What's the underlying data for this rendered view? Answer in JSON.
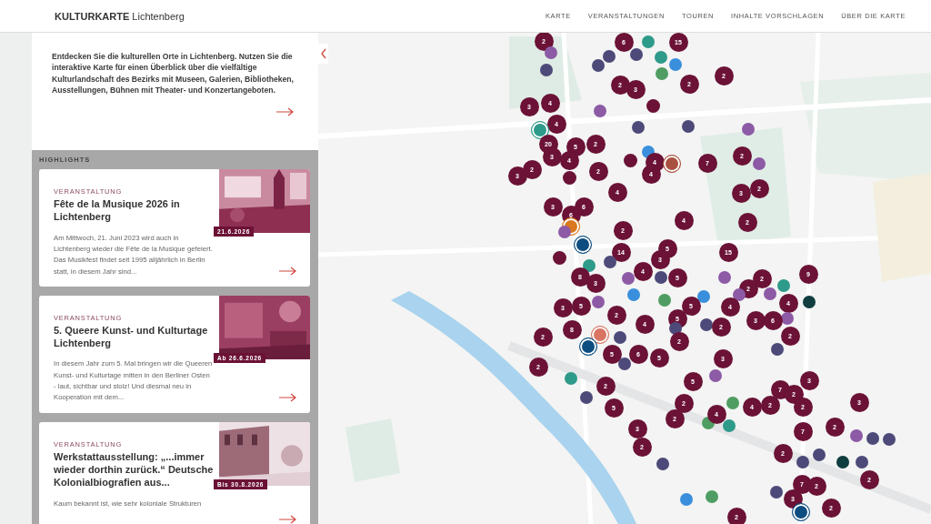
{
  "header": {
    "brand": "KULTURKARTE",
    "brand_suffix": "Lichtenberg",
    "nav": [
      "KARTE",
      "VERANSTALTUNGEN",
      "TOUREN",
      "INHALTE VORSCHLAGEN",
      "ÜBER DIE KARTE"
    ]
  },
  "intro": {
    "text": "Entdecken Sie die kulturellen Orte in Lichtenberg. Nutzen Sie die interaktive Karte für einen Überblick über die vielfältige Kulturlandschaft des Bezirks mit Museen, Galerien, Bibliotheken, Ausstellungen, Bühnen mit Theater- und Konzertangeboten."
  },
  "highlights": {
    "title": "HIGHLIGHTS",
    "cards": [
      {
        "category": "VERANSTALTUNG",
        "title": "Fête de la Musique 2026 in Lichtenberg",
        "description": "Am Mittwoch, 21. Juni 2023 wird auch in Lichtenberg wieder die Fête de la Musique gefeiert. Das Musikfest findet seit 1995 alljährlich in Berlin statt, in diesem Jahr sind...",
        "date": "21.6.2026"
      },
      {
        "category": "VERANSTALTUNG",
        "title": "5. Queere Kunst- und Kulturtage Lichtenberg",
        "description": "In diesem Jahr zum 5. Mal bringen wir die Queeren Kunst- und Kulturtage mitten in den Berliner Osten - laut, sichtbar und stolz! Und diesmal neu in Kooperation mit dem...",
        "date": "Ab 26.6.2026"
      },
      {
        "category": "VERANSTALTUNG",
        "title": "Werkstattausstellung: „...immer wieder dorthin zurück.“ Deutsche Kolonialbiografien aus...",
        "description": "Kaum bekannt ist, wie sehr koloniale Strukturen",
        "date": "Bis 30.8.2026"
      }
    ]
  },
  "map": {
    "markers": [
      {
        "kind": "cluster",
        "count": "2"
      },
      {
        "kind": "cluster",
        "count": "6"
      },
      {
        "kind": "point",
        "color": "#2e9a8a",
        "ringed": false
      },
      {
        "kind": "cluster",
        "count": "15"
      },
      {
        "kind": "point",
        "color": "#8d5aa6",
        "ringed": false
      },
      {
        "kind": "point",
        "color": "#4d4a7a",
        "ringed": false
      },
      {
        "kind": "point",
        "color": "#4d4a7a",
        "ringed": false
      },
      {
        "kind": "point",
        "color": "#2e9a8a",
        "ringed": false
      },
      {
        "kind": "point",
        "color": "#3a8fdc",
        "ringed": false
      },
      {
        "kind": "point",
        "color": "#4d4a7a",
        "ringed": false
      },
      {
        "kind": "point",
        "color": "#4d4a7a",
        "ringed": false
      },
      {
        "kind": "point",
        "color": "#4f9d62",
        "ringed": false
      },
      {
        "kind": "cluster",
        "count": "2"
      },
      {
        "kind": "cluster",
        "count": "2"
      },
      {
        "kind": "cluster",
        "count": "2"
      },
      {
        "kind": "cluster",
        "count": "3"
      },
      {
        "kind": "cluster",
        "count": "4"
      },
      {
        "kind": "cluster"
      },
      {
        "kind": "cluster",
        "count": "3"
      },
      {
        "kind": "point",
        "color": "#8d5aa6",
        "ringed": false
      },
      {
        "kind": "cluster",
        "count": "4"
      },
      {
        "kind": "point",
        "color": "#4d4a7a",
        "ringed": false
      },
      {
        "kind": "point",
        "color": "#4d4a7a",
        "ringed": false
      },
      {
        "kind": "point",
        "color": "#8d5aa6",
        "ringed": false
      },
      {
        "kind": "point",
        "color": "#2e9a8a",
        "ringed": true
      },
      {
        "kind": "cluster",
        "count": "20"
      },
      {
        "kind": "cluster",
        "count": "2"
      },
      {
        "kind": "cluster",
        "count": "5"
      },
      {
        "kind": "point",
        "color": "#3a8fdc",
        "ringed": false
      },
      {
        "kind": "cluster",
        "count": "2"
      },
      {
        "kind": "cluster",
        "count": "3"
      },
      {
        "kind": "cluster",
        "count": "4"
      },
      {
        "kind": "cluster"
      },
      {
        "kind": "cluster",
        "count": "4"
      },
      {
        "kind": "cluster",
        "count": "7"
      },
      {
        "kind": "point",
        "color": "#a9503f",
        "ringed": true
      },
      {
        "kind": "point",
        "color": "#8d5aa6",
        "ringed": false
      },
      {
        "kind": "cluster",
        "count": "2"
      },
      {
        "kind": "cluster",
        "count": "2"
      },
      {
        "kind": "cluster",
        "count": "4"
      },
      {
        "kind": "cluster",
        "count": "3"
      },
      {
        "kind": "cluster"
      },
      {
        "kind": "cluster",
        "count": "2"
      },
      {
        "kind": "cluster",
        "count": "4"
      },
      {
        "kind": "cluster",
        "count": "3"
      },
      {
        "kind": "cluster",
        "count": "3"
      },
      {
        "kind": "cluster",
        "count": "6"
      },
      {
        "kind": "cluster",
        "count": "6"
      },
      {
        "kind": "cluster",
        "count": "4"
      },
      {
        "kind": "cluster",
        "count": "2"
      },
      {
        "kind": "point",
        "color": "#d9781c",
        "ringed": true
      },
      {
        "kind": "cluster",
        "count": "2"
      },
      {
        "kind": "point",
        "color": "#8d5aa6",
        "ringed": false
      },
      {
        "kind": "point",
        "color": "#0e4d80",
        "ringed": true
      },
      {
        "kind": "cluster",
        "count": "5"
      },
      {
        "kind": "cluster",
        "count": "14"
      },
      {
        "kind": "cluster",
        "count": "15"
      },
      {
        "kind": "cluster"
      },
      {
        "kind": "cluster",
        "count": "3"
      },
      {
        "kind": "point",
        "color": "#4d4a7a",
        "ringed": false
      },
      {
        "kind": "point",
        "color": "#2e9a8a",
        "ringed": false
      },
      {
        "kind": "cluster",
        "count": "4"
      },
      {
        "kind": "cluster",
        "count": "9"
      },
      {
        "kind": "cluster",
        "count": "8"
      },
      {
        "kind": "point",
        "color": "#4d4a7a",
        "ringed": false
      },
      {
        "kind": "cluster",
        "count": "5"
      },
      {
        "kind": "point",
        "color": "#8d5aa6",
        "ringed": false
      },
      {
        "kind": "point",
        "color": "#8d5aa6",
        "ringed": false
      },
      {
        "kind": "cluster",
        "count": "2"
      },
      {
        "kind": "cluster",
        "count": "3"
      },
      {
        "kind": "point",
        "color": "#2e9a8a",
        "ringed": false
      },
      {
        "kind": "cluster",
        "count": "2"
      },
      {
        "kind": "point",
        "color": "#8d5aa6",
        "ringed": false
      },
      {
        "kind": "point",
        "color": "#8d5aa6",
        "ringed": false
      },
      {
        "kind": "point",
        "color": "#3a8fdc",
        "ringed": false
      },
      {
        "kind": "point",
        "color": "#3a8fdc",
        "ringed": false
      },
      {
        "kind": "point",
        "color": "#4f9d62",
        "ringed": false
      },
      {
        "kind": "point",
        "color": "#8d5aa6",
        "ringed": false
      },
      {
        "kind": "point",
        "color": "#0f3d40",
        "ringed": false
      },
      {
        "kind": "cluster",
        "count": "4"
      },
      {
        "kind": "cluster",
        "count": "3"
      },
      {
        "kind": "cluster",
        "count": "5"
      },
      {
        "kind": "cluster",
        "count": "5"
      },
      {
        "kind": "cluster",
        "count": "4"
      },
      {
        "kind": "cluster",
        "count": "2"
      },
      {
        "kind": "cluster",
        "count": "5"
      },
      {
        "kind": "point",
        "color": "#8d5aa6",
        "ringed": false
      },
      {
        "kind": "cluster",
        "count": "3"
      },
      {
        "kind": "cluster",
        "count": "6"
      },
      {
        "kind": "cluster",
        "count": "4"
      },
      {
        "kind": "point",
        "color": "#4d4a7a",
        "ringed": false
      },
      {
        "kind": "cluster",
        "count": "2"
      },
      {
        "kind": "point",
        "color": "#4d4a7a",
        "ringed": false
      },
      {
        "kind": "cluster",
        "count": "8"
      },
      {
        "kind": "point",
        "color": "#d97462",
        "ringed": true
      },
      {
        "kind": "cluster",
        "count": "2"
      },
      {
        "kind": "cluster",
        "count": "2"
      },
      {
        "kind": "point",
        "color": "#4d4a7a",
        "ringed": false
      },
      {
        "kind": "cluster",
        "count": "2"
      },
      {
        "kind": "point",
        "color": "#0e4d80",
        "ringed": true
      },
      {
        "kind": "point",
        "color": "#4d4a7a",
        "ringed": false
      },
      {
        "kind": "cluster",
        "count": "5"
      },
      {
        "kind": "cluster",
        "count": "6"
      },
      {
        "kind": "cluster",
        "count": "5"
      },
      {
        "kind": "cluster",
        "count": "3"
      },
      {
        "kind": "point",
        "color": "#4d4a7a",
        "ringed": false
      },
      {
        "kind": "cluster",
        "count": "2"
      },
      {
        "kind": "point",
        "color": "#8d5aa6",
        "ringed": false
      },
      {
        "kind": "point",
        "color": "#2e9a8a",
        "ringed": false
      },
      {
        "kind": "cluster",
        "count": "3"
      },
      {
        "kind": "cluster",
        "count": "5"
      },
      {
        "kind": "cluster",
        "count": "2"
      },
      {
        "kind": "cluster",
        "count": "7"
      },
      {
        "kind": "cluster",
        "count": "2"
      },
      {
        "kind": "point",
        "color": "#4d4a7a",
        "ringed": false
      },
      {
        "kind": "cluster",
        "count": "5"
      },
      {
        "kind": "cluster",
        "count": "2"
      },
      {
        "kind": "point",
        "color": "#4f9d62",
        "ringed": false
      },
      {
        "kind": "cluster",
        "count": "4"
      },
      {
        "kind": "cluster",
        "count": "2"
      },
      {
        "kind": "cluster",
        "count": "2"
      },
      {
        "kind": "cluster",
        "count": "3"
      },
      {
        "kind": "cluster",
        "count": "3"
      },
      {
        "kind": "cluster",
        "count": "2"
      },
      {
        "kind": "point",
        "color": "#4f9d62",
        "ringed": false
      },
      {
        "kind": "cluster",
        "count": "4"
      },
      {
        "kind": "point",
        "color": "#2e9a8a",
        "ringed": false
      },
      {
        "kind": "cluster",
        "count": "7"
      },
      {
        "kind": "cluster",
        "count": "2"
      },
      {
        "kind": "cluster",
        "count": "2"
      },
      {
        "kind": "point",
        "color": "#8d5aa6",
        "ringed": false
      },
      {
        "kind": "point",
        "color": "#4d4a7a",
        "ringed": false
      },
      {
        "kind": "point",
        "color": "#4d4a7a",
        "ringed": false
      },
      {
        "kind": "point",
        "color": "#4d4a7a",
        "ringed": false
      },
      {
        "kind": "cluster",
        "count": "2"
      },
      {
        "kind": "point",
        "color": "#4d4a7a",
        "ringed": false
      },
      {
        "kind": "point",
        "color": "#4d4a7a",
        "ringed": false
      },
      {
        "kind": "point",
        "color": "#0f3d40",
        "ringed": false
      },
      {
        "kind": "point",
        "color": "#4d4a7a",
        "ringed": false
      },
      {
        "kind": "cluster",
        "count": "7"
      },
      {
        "kind": "cluster",
        "count": "2"
      },
      {
        "kind": "cluster",
        "count": "2"
      },
      {
        "kind": "point",
        "color": "#3a8fdc",
        "ringed": false
      },
      {
        "kind": "point",
        "color": "#4f9d62",
        "ringed": false
      },
      {
        "kind": "point",
        "color": "#4d4a7a",
        "ringed": false
      },
      {
        "kind": "cluster",
        "count": "3"
      },
      {
        "kind": "cluster",
        "count": "2"
      },
      {
        "kind": "point",
        "color": "#0e4d80",
        "ringed": true
      },
      {
        "kind": "cluster",
        "count": "2"
      }
    ]
  }
}
